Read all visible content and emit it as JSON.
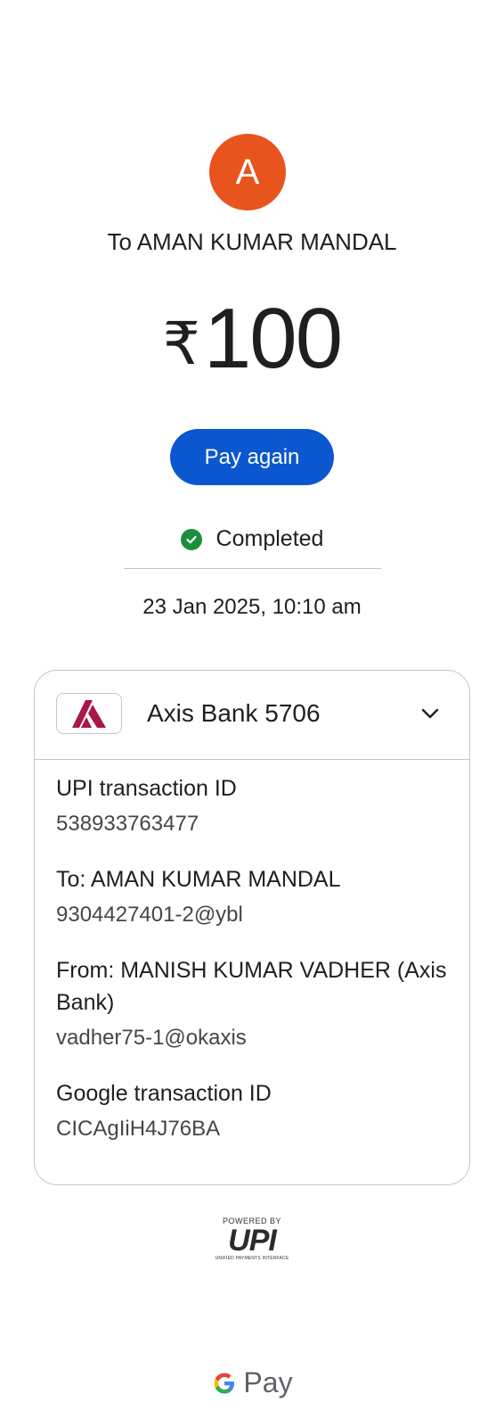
{
  "recipient": {
    "avatar_initial": "A",
    "avatar_color": "#e8541e",
    "to_label": "To AMAN KUMAR MANDAL"
  },
  "amount": {
    "currency_symbol": "₹",
    "value": "100"
  },
  "actions": {
    "pay_again_label": "Pay again",
    "accent_color": "#0b57d0"
  },
  "status": {
    "icon": "check-circle-icon",
    "text": "Completed",
    "color": "#1e8e3e"
  },
  "datetime": "23 Jan 2025, 10:10 am",
  "card": {
    "bank_icon": "axis-bank-logo",
    "bank_name": "Axis Bank 5706",
    "expand_icon": "chevron-down-icon",
    "details": [
      {
        "label": "UPI transaction ID",
        "value": "538933763477"
      },
      {
        "label": "To: AMAN KUMAR MANDAL",
        "value": "9304427401-2@ybl"
      },
      {
        "label": "From: MANISH KUMAR VADHER (Axis Bank)",
        "value": "vadher75-1@okaxis"
      },
      {
        "label": "Google transaction ID",
        "value": "CICAgIiH4J76BA"
      }
    ]
  },
  "footer": {
    "powered_by": "POWERED BY",
    "upi_logo_text": "UPI",
    "upi_subtitle": "UNIFIED PAYMENTS INTERFACE",
    "brand_g": "G",
    "brand_pay": "Pay"
  }
}
